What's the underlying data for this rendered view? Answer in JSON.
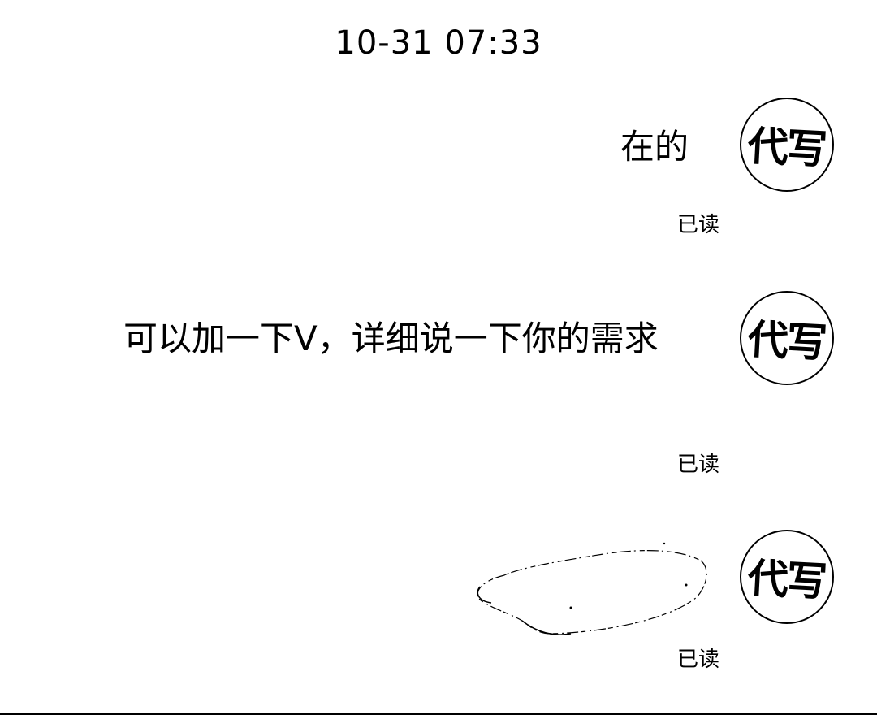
{
  "chat": {
    "timestamp": "10-31 07:33",
    "messages": [
      {
        "text": "在的",
        "status": "已读",
        "avatar_label": "代写"
      },
      {
        "text": "可以加一下V，详细说一下你的需求",
        "status": "已读",
        "avatar_label": "代写"
      },
      {
        "text": "",
        "status": "已读",
        "avatar_label": "代写"
      }
    ]
  },
  "colors": {
    "background": "#ffffff",
    "text": "#000000"
  }
}
